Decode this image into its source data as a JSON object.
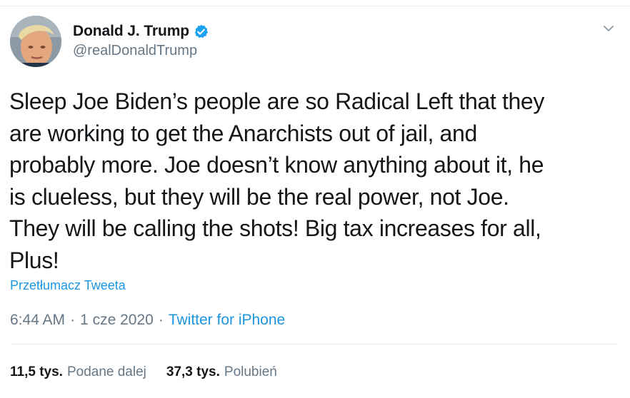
{
  "author": {
    "display_name": "Donald J. Trump",
    "handle": "@realDonaldTrump",
    "verified": true
  },
  "tweet": {
    "text": "Sleep Joe Biden’s people are so Radical Left that they\nare working to get the Anarchists out of jail, and\nprobably more. Joe doesn’t know anything about it, he\nis clueless, but they will be the real power, not Joe.\nThey will be calling the shots! Big tax increases for all,\nPlus!",
    "translate_label": "Przetłumacz Tweeta"
  },
  "meta": {
    "time": "6:44 AM",
    "separator": "·",
    "date": "1 cze 2020",
    "source": "Twitter for iPhone"
  },
  "stats": {
    "retweets_count": "11,5 tys.",
    "retweets_label": "Podane dalej",
    "likes_count": "37,3 tys.",
    "likes_label": "Polubień"
  },
  "colors": {
    "link": "#1b95e0",
    "verified_badge": "#1da1f2",
    "secondary_text": "#657786",
    "primary_text": "#14171a",
    "divider": "#e6ecf0"
  },
  "icons": {
    "verified": "verified-badge-icon",
    "more": "chevron-down-icon"
  }
}
